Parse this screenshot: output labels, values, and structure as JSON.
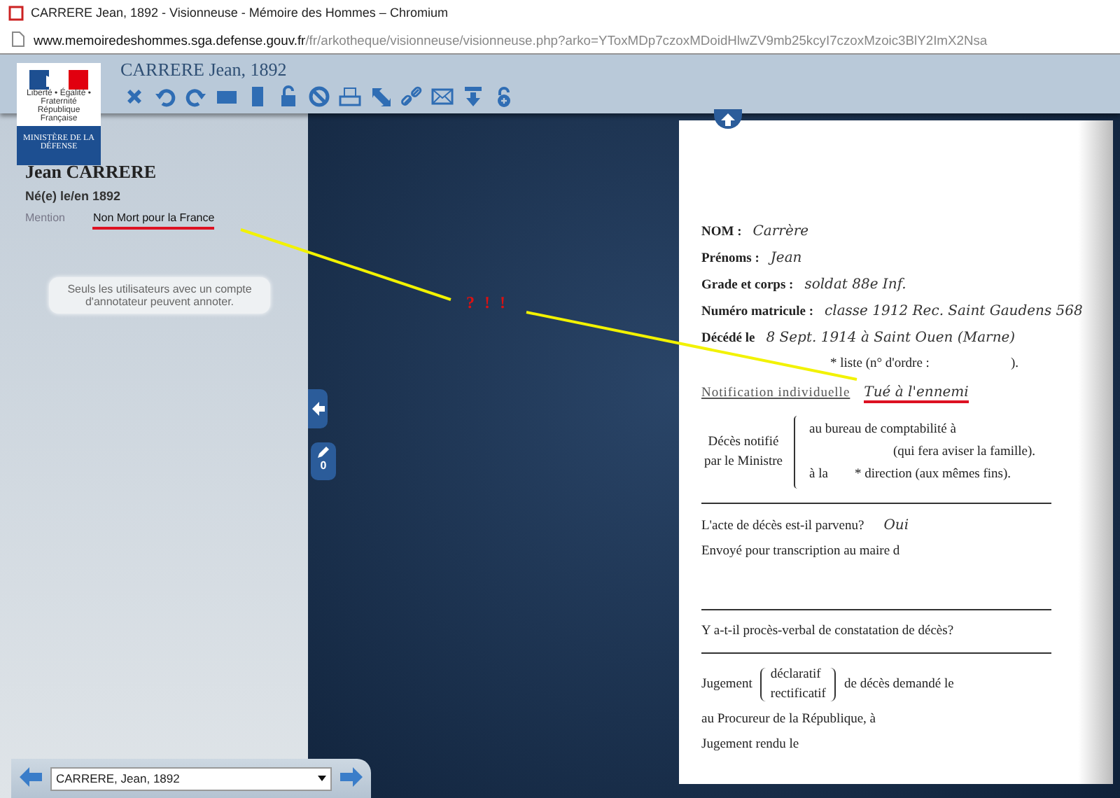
{
  "window": {
    "title": "CARRERE Jean, 1892 - Visionneuse - Mémoire des Hommes – Chromium"
  },
  "address_bar": {
    "host": "www.memoiredeshommes.sga.defense.gouv.fr",
    "path": "/fr/arkotheque/visionneuse/visionneuse.php?arko=YToxMDp7czoxMDoidHlwZV9mb25kcyI7czoxMzoic3BlY2ImX2Nsa"
  },
  "logo": {
    "caption_lines": [
      "Liberté • Égalité • Fraternité",
      "République Française"
    ],
    "ministry": "MINISTÈRE DE LA DÉFENSE"
  },
  "header": {
    "title": "CARRERE Jean, 1892"
  },
  "person": {
    "name": "Jean CARRERE",
    "birth": "Né(e) le/en 1892",
    "mention_label": "Mention",
    "mention_value": "Non Mort pour la France",
    "mention_highlighted": true,
    "notice": "Seuls les utilisateurs avec un compte d'annotateur peuvent annoter."
  },
  "viewer": {
    "annotation_count": "0",
    "annotation_mark": "? ! !"
  },
  "document": {
    "fields": [
      {
        "label": "NOM :",
        "value": "Carrère"
      },
      {
        "label": "Prénoms :",
        "value": "Jean"
      },
      {
        "label": "Grade et corps :",
        "value": "soldat 88e Inf."
      },
      {
        "label": "Numéro matricule :",
        "value": "classe 1912 Rec. Saint Gaudens 568"
      },
      {
        "label": "Décédé le",
        "value": "8 Sept. 1914 à Saint Ouen (Marne)"
      }
    ],
    "list_label": "* liste (n° d'ordre :",
    "list_suffix": ").",
    "notification_label": "Notification individuelle",
    "notification_value": "Tué à l'ennemi",
    "notification_highlighted": true,
    "notified_label": "Décès notifié par le Ministre",
    "notified_lines": [
      "au bureau de comptabilité à",
      "(qui fera aviser la famille).",
      "à la        * direction (aux mêmes fins)."
    ],
    "act_question": "L'acte de décès est-il parvenu?",
    "act_answer": "Oui",
    "transcription": "Envoyé pour transcription au maire d",
    "report_question": "Y a-t-il procès-verbal de constatation de décès?",
    "judgement_label": "Jugement",
    "judgement_options": [
      "déclaratif",
      "rectificatif"
    ],
    "judgement_text": "de décès demandé le",
    "prosecutor": "au Procureur de la République, à",
    "judgement_given": "Jugement rendu le"
  },
  "navigator": {
    "value": "CARRERE, Jean, 1892"
  }
}
